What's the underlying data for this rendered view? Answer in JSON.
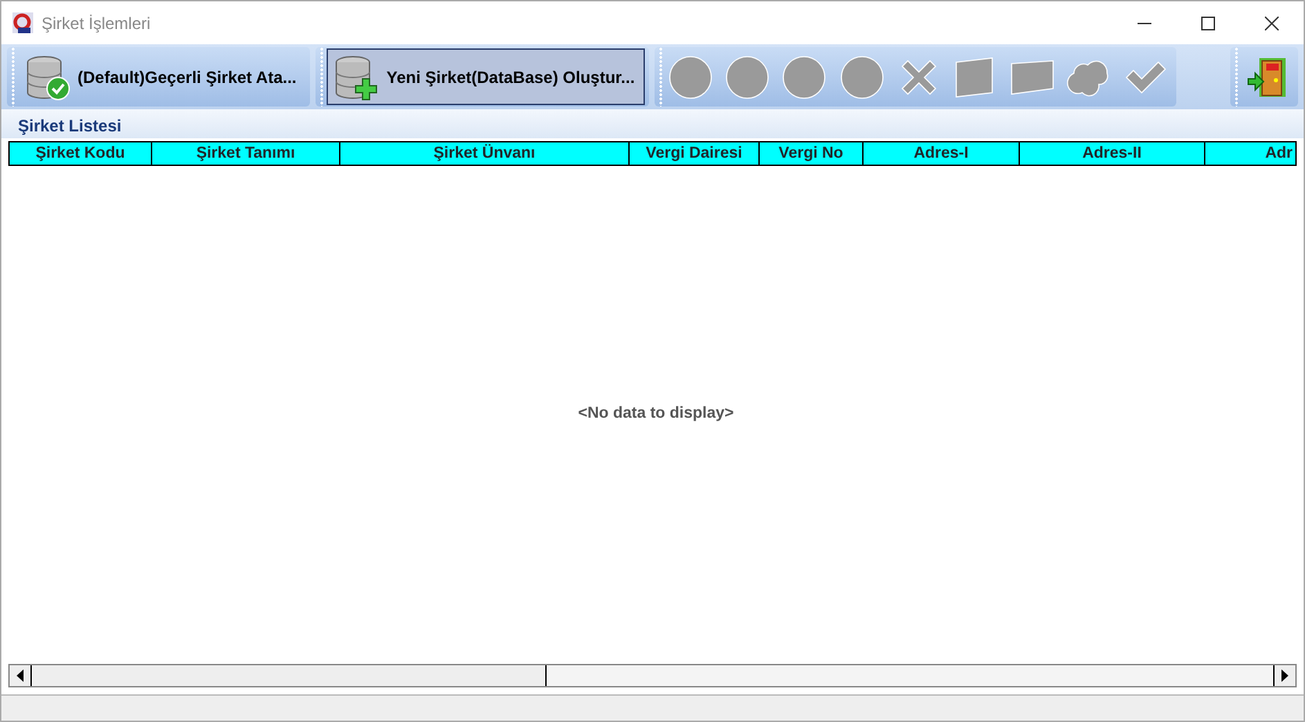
{
  "window": {
    "title": "Şirket İşlemleri"
  },
  "toolbar": {
    "buttons": [
      {
        "label": "(Default)Geçerli Şirket Ata...",
        "kind": "check",
        "selected": false
      },
      {
        "label": "Yeni Şirket(DataBase) Oluştur...",
        "kind": "add",
        "selected": true
      }
    ],
    "icon_buttons": [
      {
        "kind": "circle",
        "disabled": true
      },
      {
        "kind": "circle",
        "disabled": true
      },
      {
        "kind": "circle",
        "disabled": true
      },
      {
        "kind": "circle",
        "disabled": true
      },
      {
        "kind": "cross",
        "disabled": true
      },
      {
        "kind": "square",
        "disabled": true
      },
      {
        "kind": "flag",
        "disabled": true
      },
      {
        "kind": "blob",
        "disabled": true
      },
      {
        "kind": "tick",
        "disabled": true
      }
    ]
  },
  "panel": {
    "title": "Şirket Listesi"
  },
  "table": {
    "columns": [
      "Şirket Kodu",
      "Şirket Tanımı",
      "Şirket Ünvanı",
      "Vergi Dairesi",
      "Vergi No",
      "Adres-I",
      "Adres-II",
      "Adr"
    ],
    "empty_text": "<No data to display>"
  }
}
